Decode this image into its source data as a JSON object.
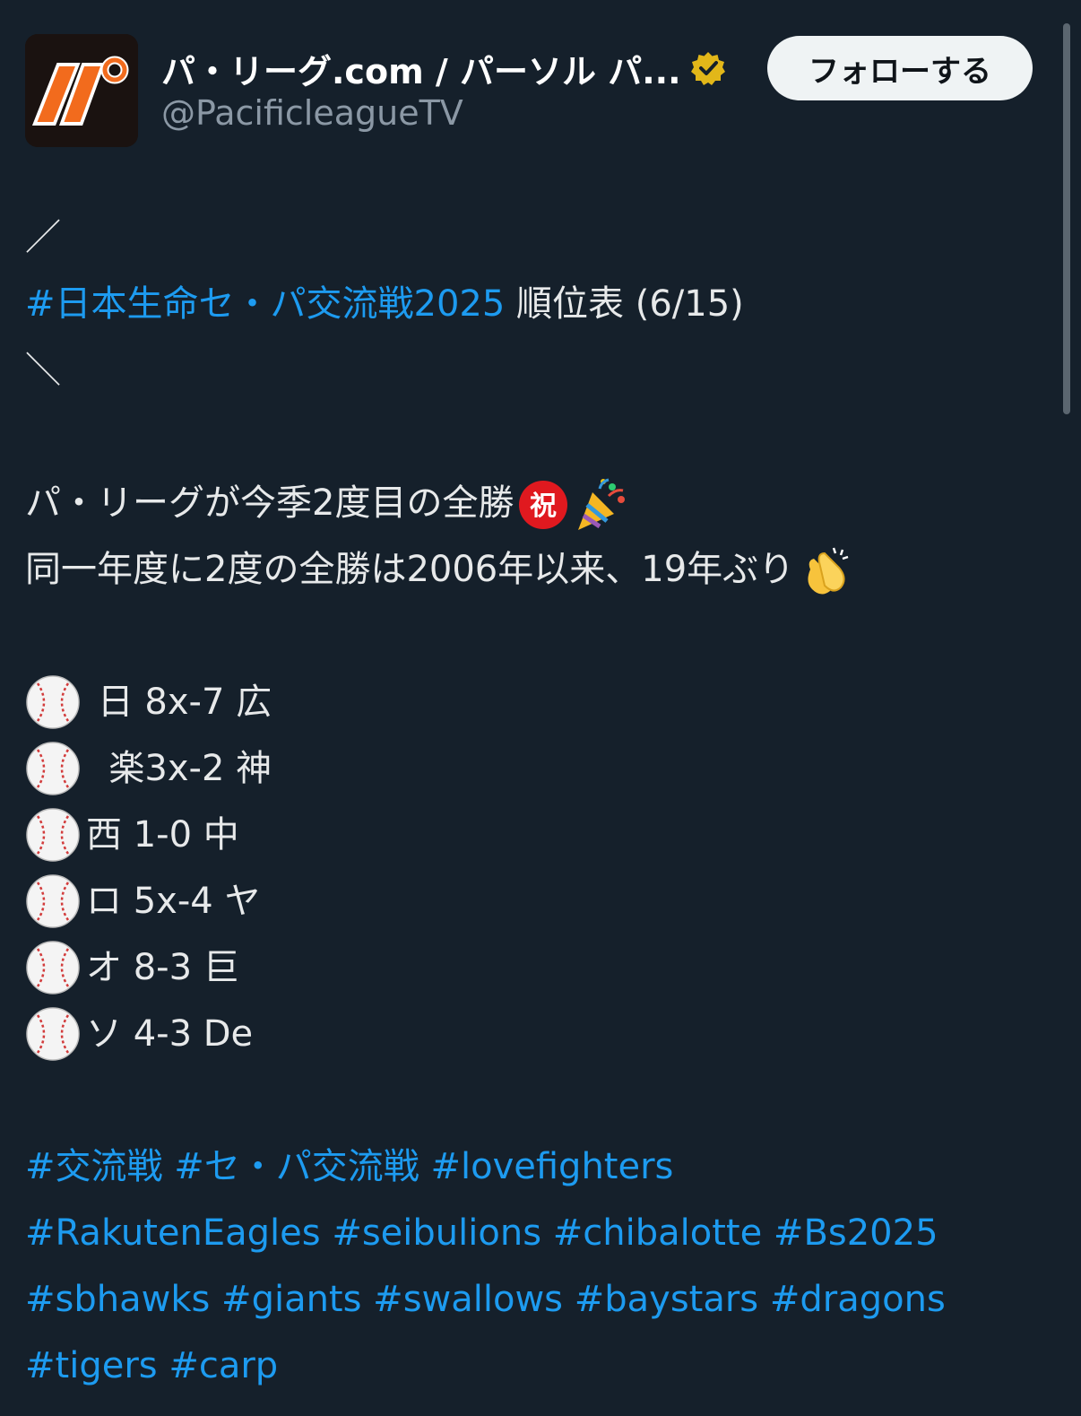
{
  "account": {
    "display_name": "パ・リーグ.com / パーソル パ...",
    "handle": "@PacificleagueTV",
    "logo_text": "パ",
    "verified_icon": "verified-badge-icon",
    "follow_label": "フォローする"
  },
  "post": {
    "slash_top": "／",
    "title_hashtag": "#日本生命セ・パ交流戦2025",
    "title_rest": " 順位表 (6/15)",
    "slash_bottom": "＼",
    "line1": "パ・リーグが今季2度目の全勝",
    "line1_emojis": [
      "celebration-symbol-icon",
      "party-popper-icon"
    ],
    "line2": "同一年度に2度の全勝は2006年以来、19年ぶり",
    "line2_emoji": "clapping-hands-icon",
    "scores": [
      " 日 8x-7 広",
      "  楽3x-2 神",
      "西 1-0 中",
      "ロ 5x-4 ヤ",
      "オ 8-3 巨",
      "ソ 4-3 De"
    ],
    "score_icon": "baseball-icon",
    "hashtag_lines": [
      [
        "#交流戦",
        "#セ・パ交流戦",
        "#lovefighters"
      ],
      [
        "#RakutenEagles",
        "#seibulions",
        "#chibalotte",
        "#Bs2025"
      ],
      [
        "#sbhawks",
        "#giants",
        "#swallows",
        "#baystars",
        "#dragons"
      ],
      [
        "#tigers",
        "#carp"
      ]
    ]
  },
  "colors": {
    "background": "#15202b",
    "text": "#e7e9ea",
    "link": "#1d9bf0",
    "muted": "#8b98a5",
    "logo_orange": "#f26b1d",
    "verified_gold": "#e2b719"
  }
}
